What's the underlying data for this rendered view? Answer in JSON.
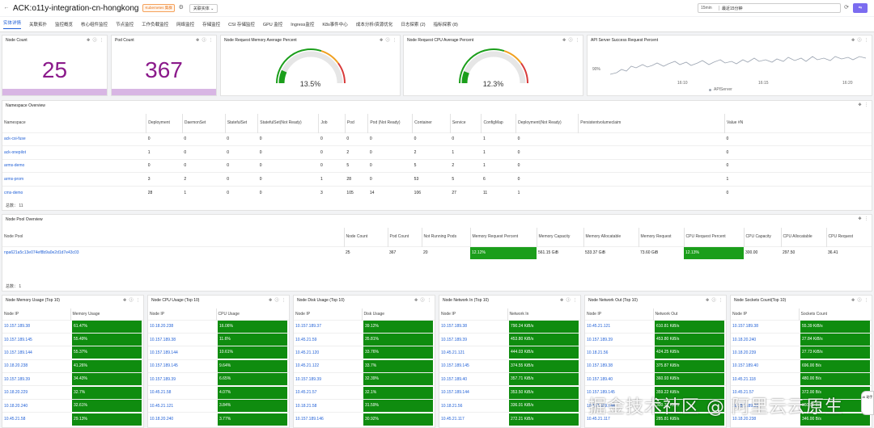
{
  "header": {
    "title": "ACK:o11y-integration-cn-hongkong",
    "badge": "Kubernetes 集群",
    "relation_label": "关联实体",
    "time_short": "15min",
    "time_range": "最近15分钟"
  },
  "tabs": [
    "实体详情",
    "关联拓扑",
    "监控概览",
    "核心组件监控",
    "节点监控",
    "工作负载监控",
    "网络监控",
    "存储监控",
    "CSI 存储监控",
    "GPU 监控",
    "Ingress监控",
    "K8s事件中心",
    "成本分析/资源优化",
    "日志探索 (2)",
    "指标探索 (8)"
  ],
  "panels": {
    "node_count": {
      "title": "Node Count",
      "value": "25"
    },
    "pod_count": {
      "title": "Pod Count",
      "value": "367"
    },
    "mem_gauge": {
      "title": "Node Request Memory Average Percent",
      "value": "13.5%",
      "fraction": 0.135
    },
    "cpu_gauge": {
      "title": "Node Request CPU Average Percent",
      "value": "12.3%",
      "fraction": 0.123
    },
    "api": {
      "title": "API Server Success Request Percent",
      "ytick": "90%",
      "xticks": [
        "16:10",
        "16:15",
        "16:20"
      ],
      "legend": "APIServer"
    }
  },
  "namespace": {
    "title": "Namespace Overview",
    "total": "总数： 11",
    "headers": [
      "Namespace",
      "Deployment",
      "DaemonSet",
      "StatefulSet",
      "StatefulSet(Not Ready)",
      "Job",
      "Pod",
      "Pod (Not Ready)",
      "Container",
      "Service",
      "ConfigMap",
      "Deployment(Not Ready)",
      "Persistentvolumeclaim",
      "Value #N"
    ],
    "rows": [
      [
        "ack-csi-fuse",
        "0",
        "0",
        "0",
        "0",
        "0",
        "0",
        "0",
        "0",
        "0",
        "1",
        "0",
        "",
        "0"
      ],
      [
        "ack-onepilot",
        "1",
        "0",
        "0",
        "0",
        "0",
        "2",
        "0",
        "2",
        "1",
        "1",
        "0",
        "",
        "0"
      ],
      [
        "arms-demo",
        "0",
        "0",
        "0",
        "0",
        "0",
        "5",
        "0",
        "5",
        "2",
        "1",
        "0",
        "",
        "0"
      ],
      [
        "arms-prom",
        "3",
        "2",
        "0",
        "0",
        "1",
        "28",
        "0",
        "53",
        "5",
        "6",
        "0",
        "",
        "1"
      ],
      [
        "cms-demo",
        "28",
        "1",
        "0",
        "0",
        "3",
        "105",
        "14",
        "106",
        "27",
        "11",
        "1",
        "",
        "0"
      ]
    ]
  },
  "nodepool": {
    "title": "Node Pool Overview",
    "total": "总数： 1",
    "headers": [
      "Node Pool",
      "Node Count",
      "Pod Count",
      "Not Running Pods",
      "Memory Request Percent",
      "Memory Capacity",
      "Memory Allocatable",
      "Memory Request",
      "CPU Request Percent",
      "CPU Capacity",
      "CPU Allocatable",
      "CPU Request"
    ],
    "row": [
      "npa621a5c13e074ef8b9a0e2d1d7e43c03",
      "25",
      "367",
      "20",
      "12.12%",
      "561.15 GiB",
      "533.37 GiB",
      "73.60 GiB",
      "12.13%",
      "300.00",
      "297.50",
      "36.41"
    ]
  },
  "tops": [
    {
      "title": "Node Memory Usage (Top 10)",
      "col": "Memory Usage",
      "rows": [
        [
          "10.157.189.38",
          "61.47%"
        ],
        [
          "10.157.189.145",
          "55.49%"
        ],
        [
          "10.157.189.144",
          "55.37%"
        ],
        [
          "10.18.20.238",
          "41.26%"
        ],
        [
          "10.157.189.39",
          "34.43%"
        ],
        [
          "10.18.20.229",
          "32.7%"
        ],
        [
          "10.18.20.240",
          "32.61%"
        ],
        [
          "10.45.21.58",
          "29.13%"
        ]
      ]
    },
    {
      "title": "Node CPU Usage (Top 10)",
      "col": "CPU Usage",
      "rows": [
        [
          "10.18.20.238",
          "16.06%"
        ],
        [
          "10.157.189.38",
          "11.6%"
        ],
        [
          "10.157.189.144",
          "10.61%"
        ],
        [
          "10.157.189.145",
          "9.64%"
        ],
        [
          "10.157.189.39",
          "6.65%"
        ],
        [
          "10.45.21.58",
          "4.07%"
        ],
        [
          "10.45.21.121",
          "3.84%"
        ],
        [
          "10.18.20.240",
          "3.77%"
        ]
      ]
    },
    {
      "title": "Node Disk Usage (Top 10)",
      "col": "Disk Usage",
      "rows": [
        [
          "10.157.189.37",
          "39.12%"
        ],
        [
          "10.45.21.59",
          "35.81%"
        ],
        [
          "10.45.21.120",
          "33.76%"
        ],
        [
          "10.45.21.122",
          "33.7%"
        ],
        [
          "10.157.189.39",
          "32.39%"
        ],
        [
          "10.45.21.57",
          "32.1%"
        ],
        [
          "10.18.21.58",
          "31.59%"
        ],
        [
          "10.157.189.146",
          "30.92%"
        ]
      ]
    },
    {
      "title": "Node Network In (Top 10)",
      "col": "Network In",
      "rows": [
        [
          "10.157.189.38",
          "790.24 KiB/s"
        ],
        [
          "10.157.189.39",
          "453.80 KiB/s"
        ],
        [
          "10.45.21.121",
          "444.03 KiB/s"
        ],
        [
          "10.157.189.145",
          "374.55 KiB/s"
        ],
        [
          "10.157.189.40",
          "357.71 KiB/s"
        ],
        [
          "10.157.189.144",
          "353.50 KiB/s"
        ],
        [
          "10.18.21.56",
          "336.01 KiB/s"
        ],
        [
          "10.45.21.117",
          "272.21 KiB/s"
        ]
      ]
    },
    {
      "title": "Node Network Out (Top 10)",
      "col": "Network Out",
      "rows": [
        [
          "10.45.21.121",
          "610.81 KiB/s"
        ],
        [
          "10.157.189.39",
          "453.80 KiB/s"
        ],
        [
          "10.18.21.56",
          "424.25 KiB/s"
        ],
        [
          "10.157.189.38",
          "375.87 KiB/s"
        ],
        [
          "10.157.189.40",
          "360.93 KiB/s"
        ],
        [
          "10.157.189.145",
          "359.22 KiB/s"
        ],
        [
          "10.157.189.144",
          "300.77 KiB/s"
        ],
        [
          "10.45.21.117",
          "285.81 KiB/s"
        ]
      ]
    },
    {
      "title": "Node Sockets Count(Top 10)",
      "col": "Sockets Count",
      "rows": [
        [
          "10.157.189.38",
          "55.39 KiB/s"
        ],
        [
          "10.18.20.240",
          "27.84 KiB/s"
        ],
        [
          "10.18.20.239",
          "27.73 KiB/s"
        ],
        [
          "10.157.189.40",
          "696.00 B/s"
        ],
        [
          "10.45.21.118",
          "480.00 B/s"
        ],
        [
          "10.45.21.57",
          "372.00 B/s"
        ],
        [
          "10.157.189.39",
          "360.00 B/s"
        ],
        [
          "10.18.20.238",
          "346.00 B/s"
        ]
      ]
    }
  ],
  "watermark": "掘金技术社区 @ 阿里云云原生",
  "float_label": "AI 助手"
}
